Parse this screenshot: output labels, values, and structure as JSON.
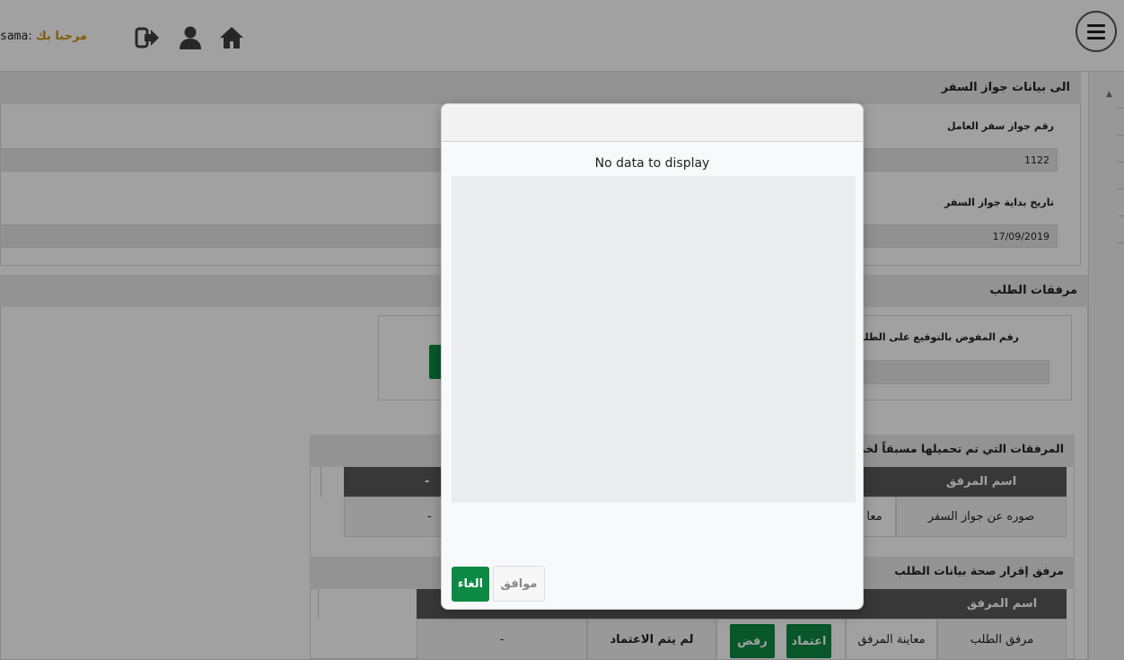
{
  "header": {
    "username": "sama",
    "welcome_label": "مرحبا بك",
    "icons": [
      "logout-icon",
      "user-icon",
      "home-icon",
      "menu-icon"
    ]
  },
  "passport": {
    "section_title": "الى بيانات جواز السفر",
    "number_label": "رقم جواز سفر العامل",
    "number_value": "1122",
    "start_date_label": "تاريخ بداية جواز السفر",
    "start_date_value": "17/09/2019"
  },
  "attachments": {
    "section_title": "مرفقات الطلب",
    "delegate_label": "رقم المفوض بالتوقيع على الطلب",
    "preloaded_title": "المرفقات التي تم تحميلها مسبقاً لخدمة :",
    "preloaded_table": {
      "headers": [
        "اسم المرفق",
        "-"
      ],
      "row": {
        "name": "صوره عن جواز السفر",
        "preview": "معا",
        "status": "-"
      }
    },
    "declaration_title": "مرفق إقرار صحة بيانات الطلب",
    "declaration_table": {
      "headers": [
        "اسم المرفق"
      ],
      "row": {
        "name": "مرفق الطلب",
        "preview": "معاينة المرفق",
        "approve_label": "اعتماد",
        "reject_label": "رفض",
        "status": "لم يتم الاعتماد",
        "note": "-"
      }
    }
  },
  "modal": {
    "message": "No data to display",
    "cancel_label": "الغاء",
    "ok_label": "موافق"
  },
  "colors": {
    "accent_green": "#0c8a43",
    "welcome_gold": "#c7920e",
    "table_header": "#5a5a5a"
  }
}
